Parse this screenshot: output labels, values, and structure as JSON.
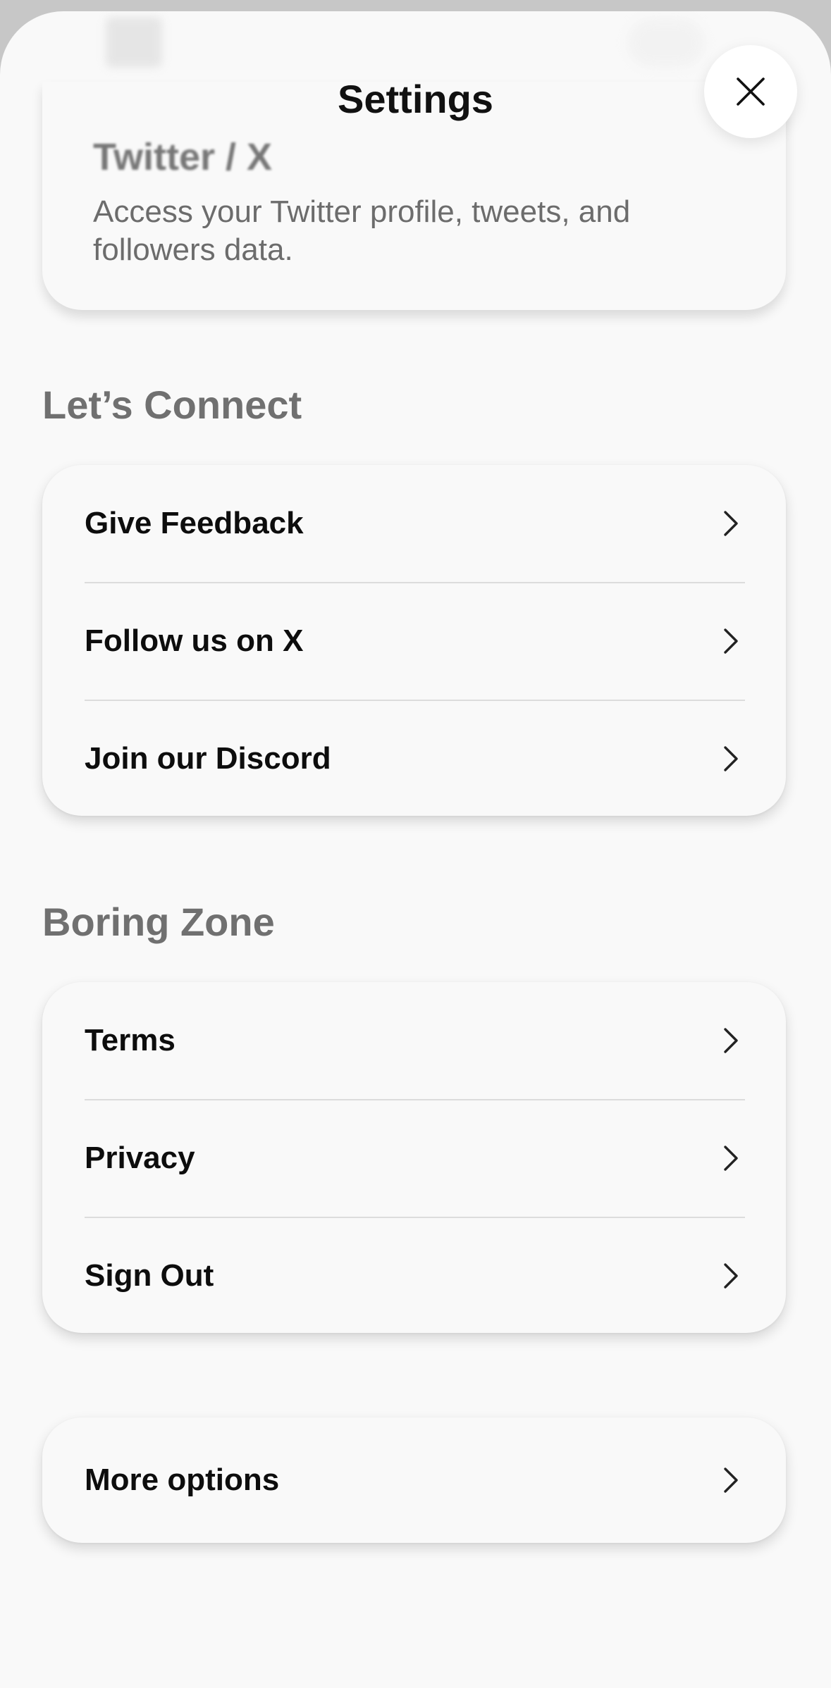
{
  "header": {
    "title": "Settings"
  },
  "twitter_card": {
    "title": "Twitter / X",
    "description": "Access your Twitter profile, tweets, and followers data."
  },
  "connect_section": {
    "title": "Let’s Connect",
    "items": [
      {
        "label": "Give Feedback"
      },
      {
        "label": "Follow us on X"
      },
      {
        "label": "Join our Discord"
      }
    ]
  },
  "boring_section": {
    "title": "Boring Zone",
    "items": [
      {
        "label": "Terms"
      },
      {
        "label": "Privacy"
      },
      {
        "label": "Sign Out"
      }
    ]
  },
  "more": {
    "label": "More options"
  },
  "icons": {
    "close": "close-icon",
    "chevron": "chevron-right-icon"
  }
}
